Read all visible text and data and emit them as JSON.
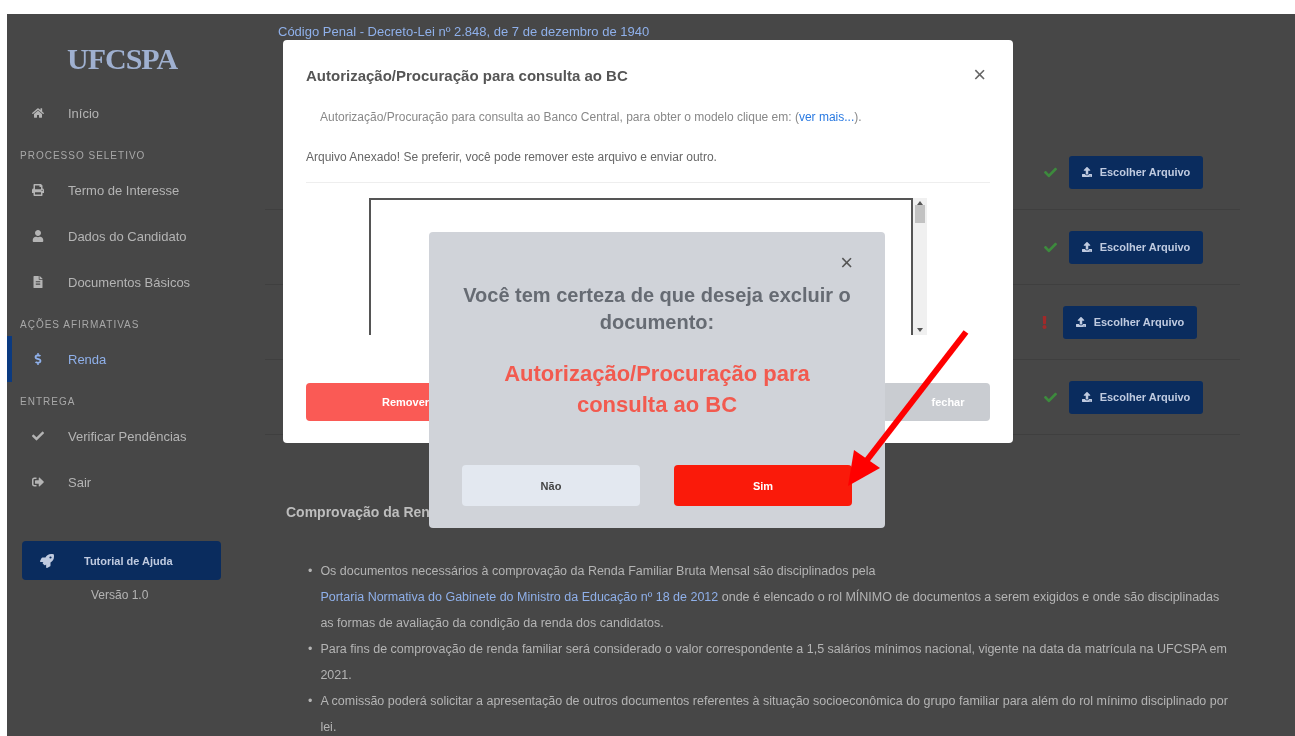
{
  "sidebar": {
    "logo": "UFCSPA",
    "items": [
      {
        "kind": "home",
        "label": "Início",
        "selected": false
      },
      {
        "kind": "section",
        "label": "PROCESSO SELETIVO"
      },
      {
        "kind": "print",
        "label": "Termo de Interesse",
        "selected": false
      },
      {
        "kind": "user",
        "label": "Dados do Candidato",
        "selected": false
      },
      {
        "kind": "file",
        "label": "Documentos Básicos",
        "selected": false
      },
      {
        "kind": "section",
        "label": "AÇÕES AFIRMATIVAS"
      },
      {
        "kind": "dollar",
        "label": "Renda",
        "selected": true
      },
      {
        "kind": "section",
        "label": "ENTREGA"
      },
      {
        "kind": "check",
        "label": "Verificar Pendências",
        "selected": false
      },
      {
        "kind": "exit",
        "label": "Sair",
        "selected": false
      }
    ],
    "help_button": "Tutorial de Ajuda",
    "version": "Versão 1.0"
  },
  "main": {
    "top_link": "Código Penal - Decreto-Lei nº 2.848, de 7 de dezembro de 1940",
    "documents": [
      {
        "complete": true,
        "button": "Escolher Arquivo"
      },
      {
        "complete": true,
        "button": "Escolher Arquivo"
      },
      {
        "complete": false,
        "button": "Escolher Arquivo"
      },
      {
        "complete": true,
        "button": "Escolher Arquivo"
      }
    ],
    "section_title": "Comprovação da Ren",
    "bullets": [
      {
        "marker": "•",
        "before": "Os documentos necessários à comprovação da Renda Familiar Bruta Mensal são disciplinados pela ",
        "link": "Portaria Normativa do Gabinete do Ministro da Educação nº 18 de 2012",
        "after": " onde é elencado o rol MÍNIMO de documentos a serem exigidos e onde são disciplinadas as formas de avaliação da condição da renda dos candidatos."
      },
      {
        "marker": "•",
        "before": "Para fins de comprovação de renda familiar será considerado o valor correspondente a 1,5 salários mínimos nacional, vigente na data da matrícula na UFCSPA em 2021."
      },
      {
        "marker": "•",
        "before": "A comissão poderá solicitar a apresentação de outros documentos referentes à situação socioeconômica do grupo familiar para além do rol mínimo disciplinado por lei."
      }
    ]
  },
  "upload_dialog": {
    "title": "Autorização/Procuração para consulta ao BC",
    "close": "×",
    "description_before": "Autorização/Procuração para consulta ao Banco Central, para obter o modelo clique em: (",
    "description_link": "ver mais...",
    "description_after": ").",
    "notice": "Arquivo Anexado! Se preferir, você pode remover este arquivo e enviar outro.",
    "remove_button": "Remover",
    "close_button": "fechar"
  },
  "confirm_dialog": {
    "close": "×",
    "question": "Você tem certeza de que deseja excluir o documento:",
    "document": "Autorização/Procuração para consulta ao BC",
    "no_button": "Não",
    "yes_button": "Sim"
  }
}
